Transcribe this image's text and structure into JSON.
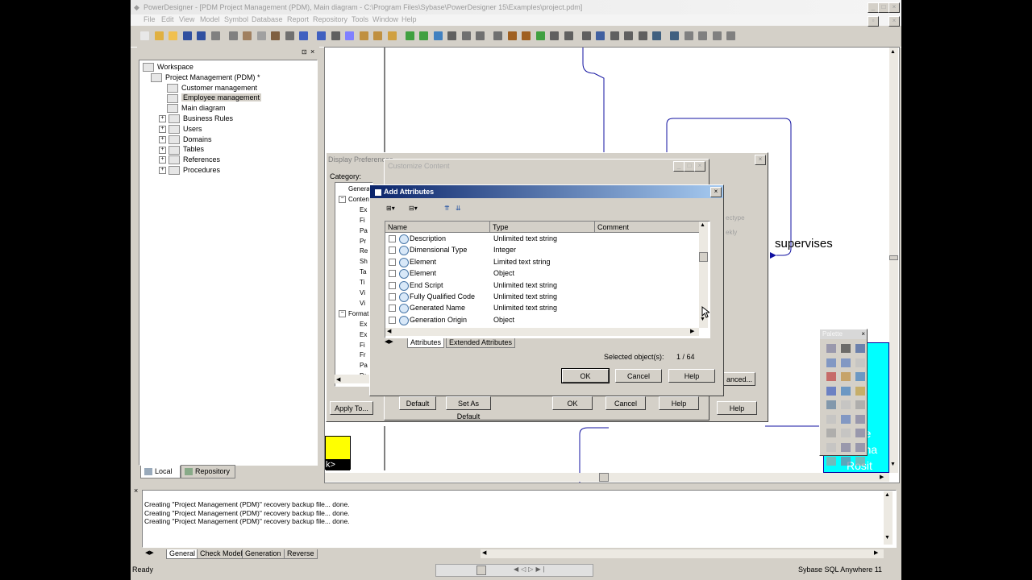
{
  "window": {
    "title": "PowerDesigner - [PDM Project Management (PDM), Main diagram - C:\\Program Files\\Sybase\\PowerDesigner 15\\Examples\\project.pdm]"
  },
  "menu": [
    "File",
    "Edit",
    "View",
    "Model",
    "Symbol",
    "Database",
    "Report",
    "Repository",
    "Tools",
    "Window",
    "Help"
  ],
  "browser": {
    "items": [
      {
        "label": "Workspace",
        "indent": 0
      },
      {
        "label": "Project Management (PDM) *",
        "indent": 1
      },
      {
        "label": "Customer management",
        "indent": 2
      },
      {
        "label": "Employee management",
        "indent": 2,
        "selected": true
      },
      {
        "label": "Main diagram",
        "indent": 2
      },
      {
        "label": "Business Rules",
        "indent": 2,
        "expandable": true
      },
      {
        "label": "Users",
        "indent": 2,
        "expandable": true
      },
      {
        "label": "Domains",
        "indent": 2,
        "expandable": true
      },
      {
        "label": "Tables",
        "indent": 2,
        "expandable": true
      },
      {
        "label": "References",
        "indent": 2,
        "expandable": true
      },
      {
        "label": "Procedures",
        "indent": 2,
        "expandable": true
      }
    ],
    "tabs": {
      "local": "Local",
      "repository": "Repository"
    }
  },
  "diagram": {
    "supervises": "supervises",
    "tag": "k>",
    "cyan_text": [
      "t nu",
      "ate",
      "ate",
      "mer",
      "oyee",
      "ect na",
      "Rosit"
    ]
  },
  "display_prefs": {
    "title": "Display Preferences",
    "category_label": "Category:",
    "tree": [
      {
        "label": "General",
        "indent": 0
      },
      {
        "label": "Content",
        "indent": 0,
        "expanded": true
      },
      {
        "label": "Ex",
        "indent": 1
      },
      {
        "label": "Fi",
        "indent": 1
      },
      {
        "label": "Pa",
        "indent": 1
      },
      {
        "label": "Pr",
        "indent": 1
      },
      {
        "label": "Re",
        "indent": 1
      },
      {
        "label": "Sh",
        "indent": 1
      },
      {
        "label": "Ta",
        "indent": 1
      },
      {
        "label": "Ti",
        "indent": 1
      },
      {
        "label": "Vi",
        "indent": 1
      },
      {
        "label": "Vi",
        "indent": 1
      },
      {
        "label": "Format",
        "indent": 0,
        "expanded": true
      },
      {
        "label": "Ex",
        "indent": 1
      },
      {
        "label": "Ex",
        "indent": 1
      },
      {
        "label": "Fi",
        "indent": 1
      },
      {
        "label": "Fr",
        "indent": 1
      },
      {
        "label": "Pa",
        "indent": 1
      },
      {
        "label": "Pr",
        "indent": 1
      }
    ],
    "side_labels": [
      "ectype",
      "ekly"
    ],
    "advanced": "anced...",
    "buttons": {
      "apply": "Apply To...",
      "ok": "OK",
      "cancel": "Cancel",
      "help": "Help"
    }
  },
  "customize": {
    "title": "Customize Content",
    "buttons": {
      "default": "Default",
      "set_default": "Set As Default",
      "ok": "OK",
      "cancel": "Cancel",
      "help": "Help"
    }
  },
  "add_attributes": {
    "title": "Add Attributes",
    "columns": [
      "Name",
      "Type",
      "Comment"
    ],
    "rows": [
      {
        "name": "Description",
        "type": "Unlimited text string",
        "comment": ""
      },
      {
        "name": "Dimensional Type",
        "type": "Integer",
        "comment": ""
      },
      {
        "name": "Element",
        "type": "Limited text string",
        "comment": ""
      },
      {
        "name": "Element",
        "type": "Object",
        "comment": ""
      },
      {
        "name": "End Script",
        "type": "Unlimited text string",
        "comment": ""
      },
      {
        "name": "Fully Qualified Code",
        "type": "Unlimited text string",
        "comment": ""
      },
      {
        "name": "Generated Name",
        "type": "Unlimited text string",
        "comment": ""
      },
      {
        "name": "Generation Origin",
        "type": "Object",
        "comment": ""
      }
    ],
    "tabs": [
      "Attributes",
      "Extended Attributes"
    ],
    "selected_label": "Selected object(s):",
    "selected_count": "1 / 64",
    "buttons": {
      "ok": "OK",
      "cancel": "Cancel",
      "help": "Help"
    }
  },
  "palette": {
    "title": "Palette"
  },
  "output": {
    "lines": [
      "Creating \"Project Management (PDM)\" recovery backup file... done.",
      "Creating \"Project Management (PDM)\" recovery backup file... done.",
      "Creating \"Project Management (PDM)\" recovery backup file... done."
    ],
    "tabs": [
      "General",
      "Check Model",
      "Generation",
      "Reverse"
    ]
  },
  "status": {
    "left": "Ready",
    "right": "Sybase SQL Anywhere 11"
  }
}
